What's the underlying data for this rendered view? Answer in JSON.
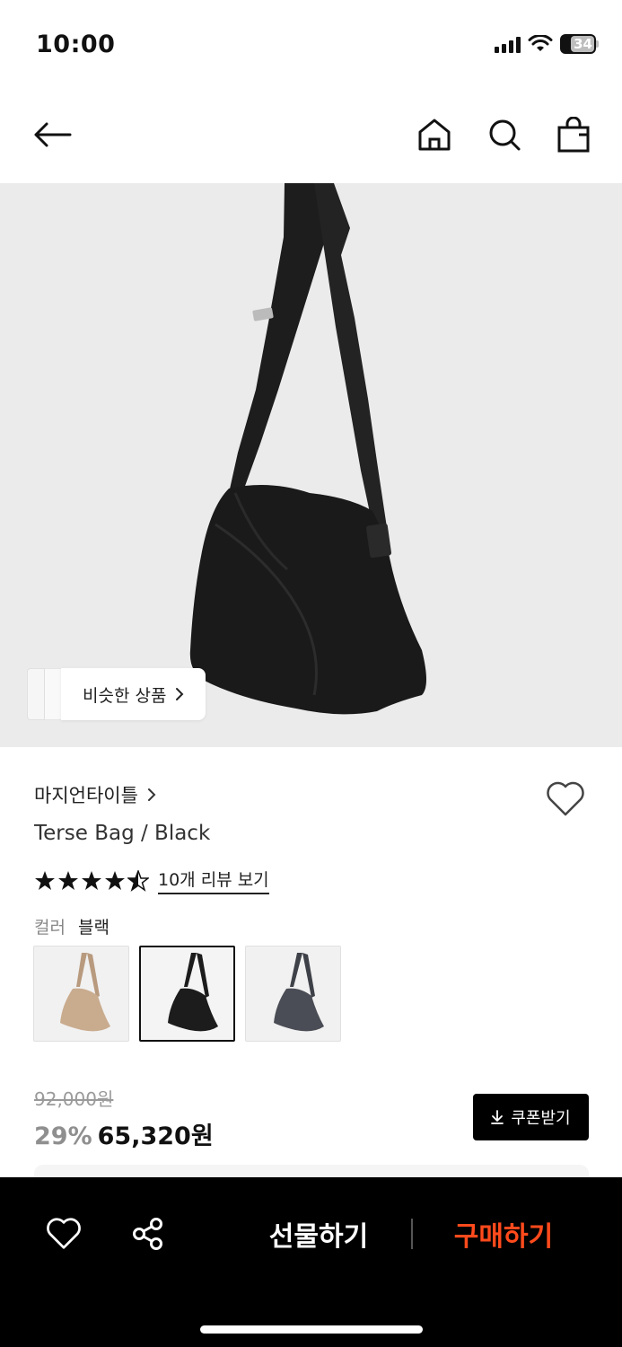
{
  "status_bar": {
    "time": "10:00",
    "battery": "34",
    "icons": [
      "signal-icon",
      "wifi-icon",
      "battery-icon"
    ]
  },
  "header": {
    "icons": [
      "back-arrow-icon",
      "home-icon",
      "search-icon",
      "shopping-bag-icon"
    ]
  },
  "hero": {
    "similar_label": "비슷한 상품"
  },
  "product": {
    "brand": "마지언타이틀",
    "name": "Terse Bag / Black",
    "rating": 4.5,
    "review_link": "10개 리뷰 보기",
    "color_label": "컬러",
    "color_value": "블랙",
    "swatches": [
      {
        "name": "beige",
        "color": "#c9ab8e",
        "selected": false
      },
      {
        "name": "black",
        "color": "#1c1c1c",
        "selected": true
      },
      {
        "name": "charcoal",
        "color": "#4a4d55",
        "selected": false
      }
    ],
    "original_price": "92,000원",
    "discount": "29%",
    "final_price": "65,320원",
    "coupon_label": "쿠폰받기"
  },
  "bottom_bar": {
    "gift_label": "선물하기",
    "buy_label": "구매하기"
  },
  "colors": {
    "buy_accent": "#ff4a1c",
    "hero_bg": "#ebebeb",
    "bar_bg": "#000000"
  }
}
